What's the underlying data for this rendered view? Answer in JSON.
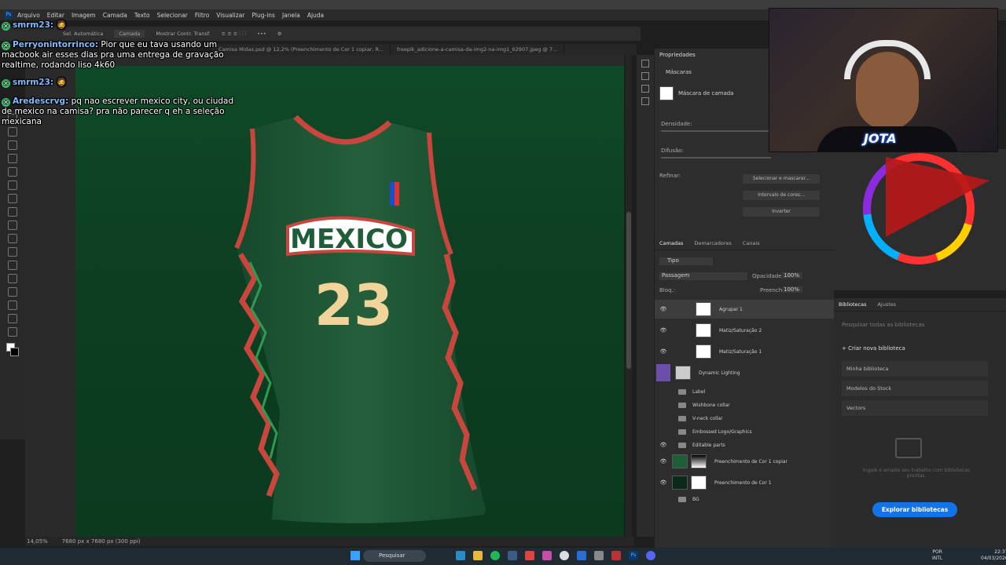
{
  "menubar": {
    "items": [
      "Arquivo",
      "Editar",
      "Imagem",
      "Camada",
      "Texto",
      "Selecionar",
      "Filtro",
      "Visualizar",
      "Plug-ins",
      "Janela",
      "Ajuda"
    ]
  },
  "options": {
    "auto_select": "Sel. Automática",
    "layer": "Camada",
    "show_transform": "Mostrar Contr. Transf."
  },
  "tabs": [
    "Camisa Midas.psd @ 12,2% (Preenchimento de Cor 1 copiar, R...",
    "freepik_adicione-a-camisa-da-img2-na-img1_62907.jpeg @ 7..."
  ],
  "background_tab": "Camisa Midas Verde.psd @ 14% (Agrupar 1, Máscara de camada/8)",
  "jersey": {
    "text": "MEXICO",
    "number": "23",
    "main_color": "#1f5c38",
    "trim_color": "#c8463d"
  },
  "status": {
    "zoom": "14,05%",
    "dimensions": "7680 px x 7680 px (300 ppi)"
  },
  "properties": {
    "title": "Propriedades",
    "masks": "Máscaras",
    "layer_mask": "Máscara de camada",
    "density": "Densidade:",
    "feather": "Difusão:",
    "refine": "Refinar:",
    "btn_select_mask": "Selecionar e mascarar...",
    "btn_color_range": "Intervalo de cores...",
    "btn_invert": "Inverter"
  },
  "layers_panel": {
    "tabs": [
      "Camadas",
      "Demarcadores",
      "Canais"
    ],
    "kind": "Tipo",
    "blend": "Passagem",
    "opacity_label": "Opacidade:",
    "opacity": "100%",
    "fill_label": "Preench.:",
    "fill": "100%",
    "lock_label": "Bloq.:",
    "layers": [
      {
        "name": "Agrupar 1",
        "kind": "group-mask",
        "visible": true
      },
      {
        "name": "Matiz/Saturação 2",
        "kind": "adjust",
        "visible": true
      },
      {
        "name": "Matiz/Saturação 1",
        "kind": "adjust",
        "visible": true
      },
      {
        "name": "Dynamic Lighting",
        "kind": "smart",
        "visible": false
      },
      {
        "name": "Label",
        "kind": "folder",
        "visible": false
      },
      {
        "name": "Wishbone collar",
        "kind": "folder",
        "visible": false
      },
      {
        "name": "V-neck collar",
        "kind": "folder",
        "visible": false
      },
      {
        "name": "Embossed Logo/Graphics",
        "kind": "folder",
        "visible": false
      },
      {
        "name": "Editable parts",
        "kind": "folder",
        "visible": true
      },
      {
        "name": "Preenchimento de Cor 1 copiar",
        "kind": "fill",
        "visible": true
      },
      {
        "name": "Preenchimento de Cor 1",
        "kind": "fill",
        "visible": true
      },
      {
        "name": "BG",
        "kind": "folder",
        "visible": false
      }
    ]
  },
  "libraries": {
    "tabs": [
      "Bibliotecas",
      "Ajustes"
    ],
    "search_placeholder": "Pesquisar todas as bibliotecas",
    "create": "+ Criar nova biblioteca",
    "items": [
      "Minha biblioteca",
      "Modelos do Stock",
      "Vectors"
    ],
    "hint": "Ingale e arraste seu trabalho com bibliotecas prontas.",
    "explore": "Explorar bibliotecas"
  },
  "chat": [
    {
      "user": "smrm23:",
      "text": ""
    },
    {
      "user": "Perryonintorrinco:",
      "text": " Pior que eu tava usando um macbook air esses dias pra uma entrega de gravação realtime, rodando liso 4k60"
    },
    {
      "user": "smrm23:",
      "text": ""
    },
    {
      "user": "Aredescrvg:",
      "text": " pq nao escrever mexico city, ou ciudad de mexico na camisa? pra não parecer q eh a seleção mexicana"
    }
  ],
  "webcam": {
    "logo": "JOTA"
  },
  "taskbar": {
    "search": "Pesquisar",
    "lang_top": "POR",
    "lang_bottom": "INTL",
    "time": "22:37",
    "date": "04/03/2026"
  }
}
